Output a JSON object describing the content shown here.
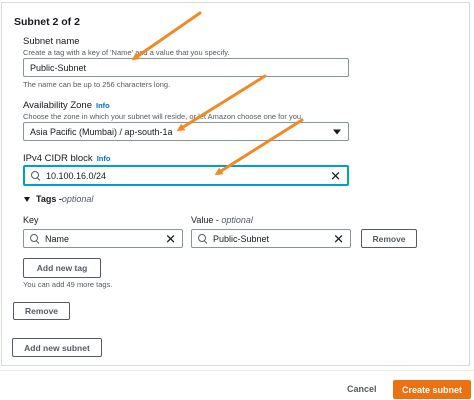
{
  "subnet_header": "Subnet 2 of 2",
  "subnet_name": {
    "label": "Subnet name",
    "description": "Create a tag with a key of 'Name' and a value that you specify.",
    "value": "Public-Subnet",
    "hint": "The name can be up to 256 characters long."
  },
  "availability_zone": {
    "label": "Availability Zone",
    "info": "Info",
    "description": "Choose the zone in which your subnet will reside, or let Amazon choose one for you.",
    "selected": "Asia Pacific (Mumbai) / ap-south-1a"
  },
  "ipv4_cidr": {
    "label": "IPv4 CIDR block",
    "info": "Info",
    "value": "10.100.16.0/24"
  },
  "tags": {
    "toggle_label": "Tags - ",
    "toggle_optional": "optional",
    "key_label": "Key",
    "value_label": "Value - ",
    "value_optional": "optional",
    "key_value": "Name",
    "tag_value": "Public-Subnet",
    "remove_tag_label": "Remove",
    "add_tag_label": "Add new tag",
    "remaining_hint": "You can add 49 more tags."
  },
  "remove_subnet_label": "Remove",
  "add_subnet_label": "Add new subnet",
  "footer": {
    "cancel_label": "Cancel",
    "create_label": "Create subnet"
  },
  "colors": {
    "accent": "#ec7211",
    "focus": "#00a1c9",
    "link": "#0073bb",
    "annotation_arrow": "#f08a24"
  }
}
